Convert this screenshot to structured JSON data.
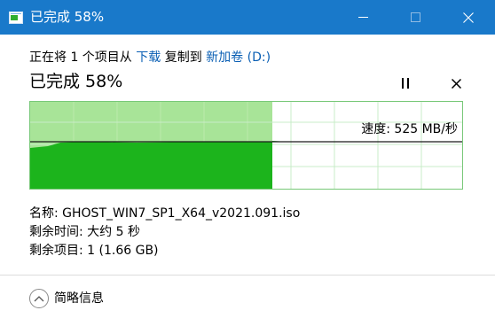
{
  "window": {
    "title": "已完成 58%"
  },
  "transfer": {
    "prefix": "正在将 1 个项目从 ",
    "source": "下载",
    "middle": " 复制到 ",
    "destination": "新加卷 (D:)",
    "heading": "已完成 58%",
    "progress_percent": 58,
    "speed_text": "速度: 525 MB/秒"
  },
  "details": {
    "name": "名称: GHOST_WIN7_SP1_X64_v2021.091.iso",
    "time_remaining": "剩余时间: 大约 5 秒",
    "items_remaining": "剩余项目: 1 (1.66 GB)"
  },
  "footer": {
    "fewer_details_label": "简略信息"
  },
  "colors": {
    "titlebar": "#1979ca",
    "graph_fill": "#1cb41c",
    "graph_background_progress": "#a8e498",
    "link": "#0a5fb4"
  },
  "icons": {
    "window_icon": "copy-progress-icon",
    "minimize": "minimize-icon",
    "maximize": "maximize-icon",
    "close": "close-icon",
    "pause": "pause-icon",
    "cancel": "cancel-icon",
    "collapse": "chevron-up-icon"
  }
}
